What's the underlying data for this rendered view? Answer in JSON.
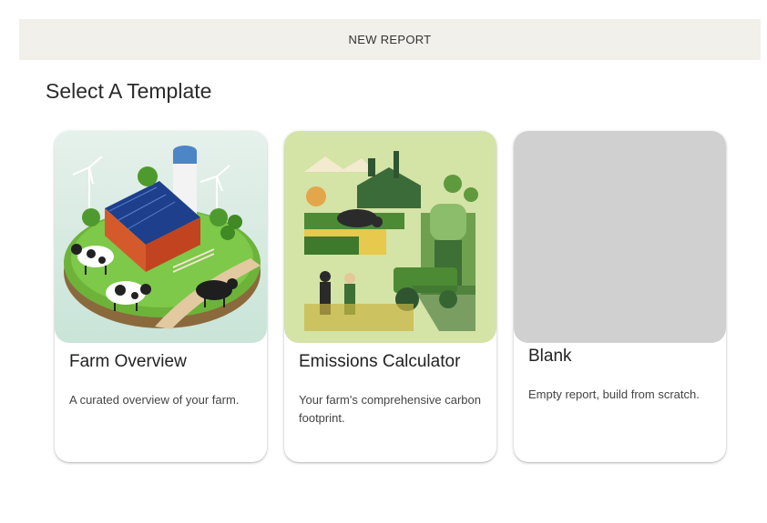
{
  "header": {
    "title": "NEW REPORT"
  },
  "page": {
    "title": "Select A Template"
  },
  "templates": [
    {
      "title": "Farm Overview",
      "description": "A curated overview of your farm.",
      "image": "isometric-farm-illustration"
    },
    {
      "title": "Emissions Calculator",
      "description": "Your farm's comprehensive carbon footprint.",
      "image": "green-agriculture-collage"
    },
    {
      "title": "Blank",
      "description": "Empty report, build from scratch.",
      "image": "blank-placeholder"
    }
  ],
  "colors": {
    "header_bg": "#f1f0eb",
    "blank_image": "#d0d0d0",
    "emissions_bg": "#d4e3a6"
  }
}
